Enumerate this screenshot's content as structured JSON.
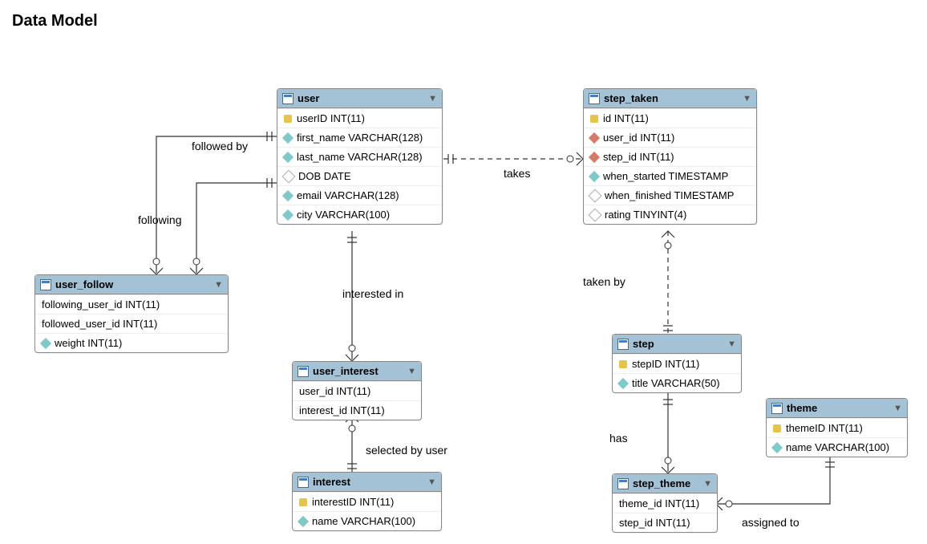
{
  "page_title": "Data Model",
  "entities": {
    "user_follow": {
      "name": "user_follow",
      "columns": [
        {
          "icon": "",
          "text": "following_user_id INT(11)"
        },
        {
          "icon": "",
          "text": "followed_user_id INT(11)"
        },
        {
          "icon": "attr",
          "text": "weight INT(11)"
        }
      ]
    },
    "user": {
      "name": "user",
      "columns": [
        {
          "icon": "pk",
          "text": "userID INT(11)"
        },
        {
          "icon": "attr",
          "text": "first_name VARCHAR(128)"
        },
        {
          "icon": "attr",
          "text": "last_name VARCHAR(128)"
        },
        {
          "icon": "empty",
          "text": "DOB DATE"
        },
        {
          "icon": "attr",
          "text": "email VARCHAR(128)"
        },
        {
          "icon": "attr",
          "text": "city VARCHAR(100)"
        }
      ]
    },
    "user_interest": {
      "name": "user_interest",
      "columns": [
        {
          "icon": "",
          "text": "user_id INT(11)"
        },
        {
          "icon": "",
          "text": "interest_id INT(11)"
        }
      ]
    },
    "interest": {
      "name": "interest",
      "columns": [
        {
          "icon": "pk",
          "text": "interestID INT(11)"
        },
        {
          "icon": "attr",
          "text": "name VARCHAR(100)"
        }
      ]
    },
    "step_taken": {
      "name": "step_taken",
      "columns": [
        {
          "icon": "pk",
          "text": "id INT(11)"
        },
        {
          "icon": "fk",
          "text": "user_id INT(11)"
        },
        {
          "icon": "fk",
          "text": "step_id INT(11)"
        },
        {
          "icon": "attr",
          "text": "when_started TIMESTAMP"
        },
        {
          "icon": "empty",
          "text": "when_finished TIMESTAMP"
        },
        {
          "icon": "empty",
          "text": "rating TINYINT(4)"
        }
      ]
    },
    "step": {
      "name": "step",
      "columns": [
        {
          "icon": "pk",
          "text": "stepID INT(11)"
        },
        {
          "icon": "attr",
          "text": "title VARCHAR(50)"
        }
      ]
    },
    "step_theme": {
      "name": "step_theme",
      "columns": [
        {
          "icon": "",
          "text": "theme_id INT(11)"
        },
        {
          "icon": "",
          "text": "step_id INT(11)"
        }
      ]
    },
    "theme": {
      "name": "theme",
      "columns": [
        {
          "icon": "pk",
          "text": "themeID INT(11)"
        },
        {
          "icon": "attr",
          "text": "name VARCHAR(100)"
        }
      ]
    }
  },
  "relationships": {
    "followed_by": "followed by",
    "following": "following",
    "takes": "takes",
    "interested_in": "interested in",
    "selected_by_user": "selected by user",
    "taken_by": "taken by",
    "has": "has",
    "assigned_to": "assigned to"
  }
}
